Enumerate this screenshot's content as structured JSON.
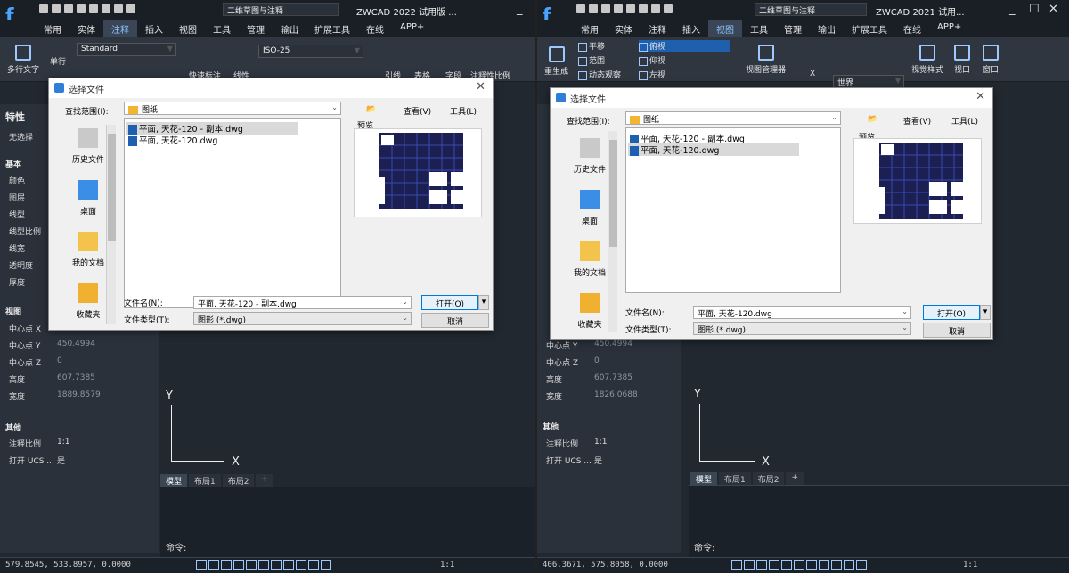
{
  "left": {
    "window_title": "ZWCAD 2022 试用版 ...",
    "workspace": "二维草图与注释",
    "menu": [
      "常用",
      "实体",
      "注释",
      "插入",
      "视图",
      "工具",
      "管理",
      "输出",
      "扩展工具",
      "在线",
      "APP+"
    ],
    "active_menu": "注释",
    "ribbon": {
      "multiline_text": "多行文字",
      "single_text": "单行",
      "text_style": "Standard",
      "dim_style": "ISO-25",
      "quick_dim": "快速标注",
      "linear": "线性",
      "leader": "引线",
      "table": "表格",
      "field": "字段",
      "anno_scale": "注释性比例"
    },
    "properties": {
      "title": "特性",
      "no_selection": "无选择",
      "basic": "基本",
      "basic_rows": [
        "颜色",
        "图层",
        "线型",
        "线型比例",
        "线宽",
        "透明度",
        "厚度"
      ],
      "view": "视图",
      "view_rows": [
        {
          "label": "中心点 X",
          "value": ""
        },
        {
          "label": "中心点 Y",
          "value": "450.4994"
        },
        {
          "label": "中心点 Z",
          "value": "0"
        },
        {
          "label": "高度",
          "value": "607.7385"
        },
        {
          "label": "宽度",
          "value": "1889.8579"
        }
      ],
      "other": "其他",
      "other_rows": [
        {
          "label": "注释比例",
          "value": "1:1"
        },
        {
          "label": "打开 UCS ...",
          "value": "是"
        }
      ]
    },
    "tabs": [
      "模型",
      "布局1",
      "布局2",
      "+"
    ],
    "command_label": "命令:",
    "coords": "579.8545, 533.8957, 0.0000",
    "scale": "1:1",
    "dialog": {
      "title": "选择文件",
      "look_in_label": "查找范围(I):",
      "look_in_value": "图纸",
      "view_label": "查看(V)",
      "tools_label": "工具(L)",
      "preview_label": "预览",
      "places": [
        "历史文件",
        "桌面",
        "我的文档",
        "收藏夹"
      ],
      "files": [
        "平面, 天花-120 - 副本.dwg",
        "平面, 天花-120.dwg"
      ],
      "selected_index": 0,
      "filename_label": "文件名(N):",
      "filename_value": "平面, 天花-120 - 副本.dwg",
      "filetype_label": "文件类型(T):",
      "filetype_value": "图形 (*.dwg)",
      "open_button": "打开(O)",
      "cancel_button": "取消"
    }
  },
  "right": {
    "window_title": "ZWCAD 2021 试用...",
    "workspace": "二维草图与注释",
    "menu": [
      "常用",
      "实体",
      "注释",
      "插入",
      "视图",
      "工具",
      "管理",
      "输出",
      "扩展工具",
      "在线",
      "APP+"
    ],
    "active_menu": "视图",
    "ribbon": {
      "regen": "重生成",
      "pan": "平移",
      "extents": "范围",
      "orbit": "动态观察",
      "top": "俯视",
      "bottom": "仰视",
      "left": "左视",
      "view_manager": "视图管理器",
      "x_label": "X",
      "world": "世界",
      "visual_style": "视觉样式",
      "viewport": "视口",
      "window": "窗口"
    },
    "properties": {
      "view_rows": [
        {
          "label": "中心点 Y",
          "value": "450.4994"
        },
        {
          "label": "中心点 Z",
          "value": "0"
        },
        {
          "label": "高度",
          "value": "607.7385"
        },
        {
          "label": "宽度",
          "value": "1826.0688"
        }
      ],
      "other": "其他",
      "other_rows": [
        {
          "label": "注释比例",
          "value": "1:1"
        },
        {
          "label": "打开 UCS ...",
          "value": "是"
        }
      ]
    },
    "tabs": [
      "模型",
      "布局1",
      "布局2",
      "+"
    ],
    "command_label": "命令:",
    "coords": "406.3671, 575.8058, 0.0000",
    "scale": "1:1",
    "dialog": {
      "title": "选择文件",
      "look_in_label": "查找范围(I):",
      "look_in_value": "图纸",
      "view_label": "查看(V)",
      "tools_label": "工具(L)",
      "preview_label": "预览",
      "places": [
        "历史文件",
        "桌面",
        "我的文档",
        "收藏夹"
      ],
      "files": [
        "平面, 天花-120 - 副本.dwg",
        "平面, 天花-120.dwg"
      ],
      "selected_index": 1,
      "filename_label": "文件名(N):",
      "filename_value": "平面, 天花-120.dwg",
      "filetype_label": "文件类型(T):",
      "filetype_value": "图形 (*.dwg)",
      "open_button": "打开(O)",
      "cancel_button": "取消"
    }
  }
}
